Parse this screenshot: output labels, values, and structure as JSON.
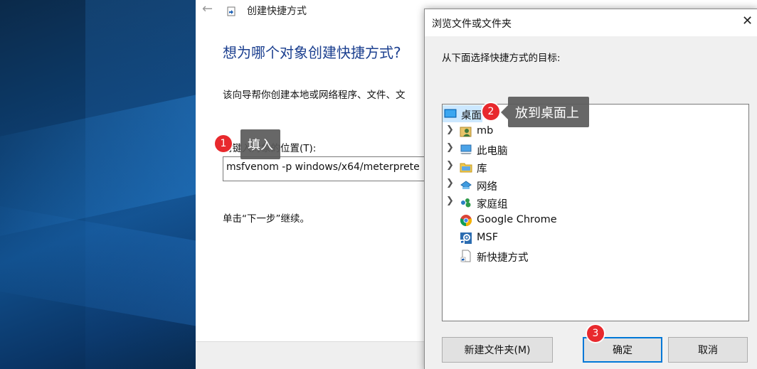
{
  "wizard": {
    "back_icon": "back-arrow-icon",
    "title": "创建快捷方式",
    "heading": "想为哪个对象创建快捷方式?",
    "description": "该向导帮你创建本地或网络程序、文件、文",
    "location_label": "请键入对象的位置(T):",
    "location_value": "msfvenom -p windows/x64/meterprete",
    "next_hint": "单击“下一步”继续。"
  },
  "dialog": {
    "title": "浏览文件或文件夹",
    "close_icon": "close-icon",
    "prompt": "从下面选择快捷方式的目标:",
    "tree": [
      {
        "label": "桌面",
        "icon": "desktop-icon",
        "expandable": false,
        "selected": true
      },
      {
        "label": "mb",
        "icon": "user-folder-icon",
        "expandable": true
      },
      {
        "label": "此电脑",
        "icon": "computer-icon",
        "expandable": true
      },
      {
        "label": "库",
        "icon": "library-icon",
        "expandable": true
      },
      {
        "label": "网络",
        "icon": "network-icon",
        "expandable": true
      },
      {
        "label": "家庭组",
        "icon": "homegroup-icon",
        "expandable": true
      },
      {
        "label": "Google Chrome",
        "icon": "chrome-shortcut-icon",
        "expandable": false
      },
      {
        "label": "MSF",
        "icon": "msf-shortcut-icon",
        "expandable": false
      },
      {
        "label": "新快捷方式",
        "icon": "shortcut-file-icon",
        "expandable": false
      }
    ],
    "buttons": {
      "new_folder": "新建文件夹(M)",
      "ok": "确定",
      "cancel": "取消"
    }
  },
  "annotations": [
    {
      "number": "1",
      "text": "填入"
    },
    {
      "number": "2",
      "text": "放到桌面上"
    },
    {
      "number": "3",
      "text": ""
    }
  ],
  "colors": {
    "heading": "#1b3f8f",
    "selection": "#cce8ff",
    "default_button_border": "#0078d7",
    "badge": "#e8292d",
    "callout": "#5a5a5a"
  }
}
